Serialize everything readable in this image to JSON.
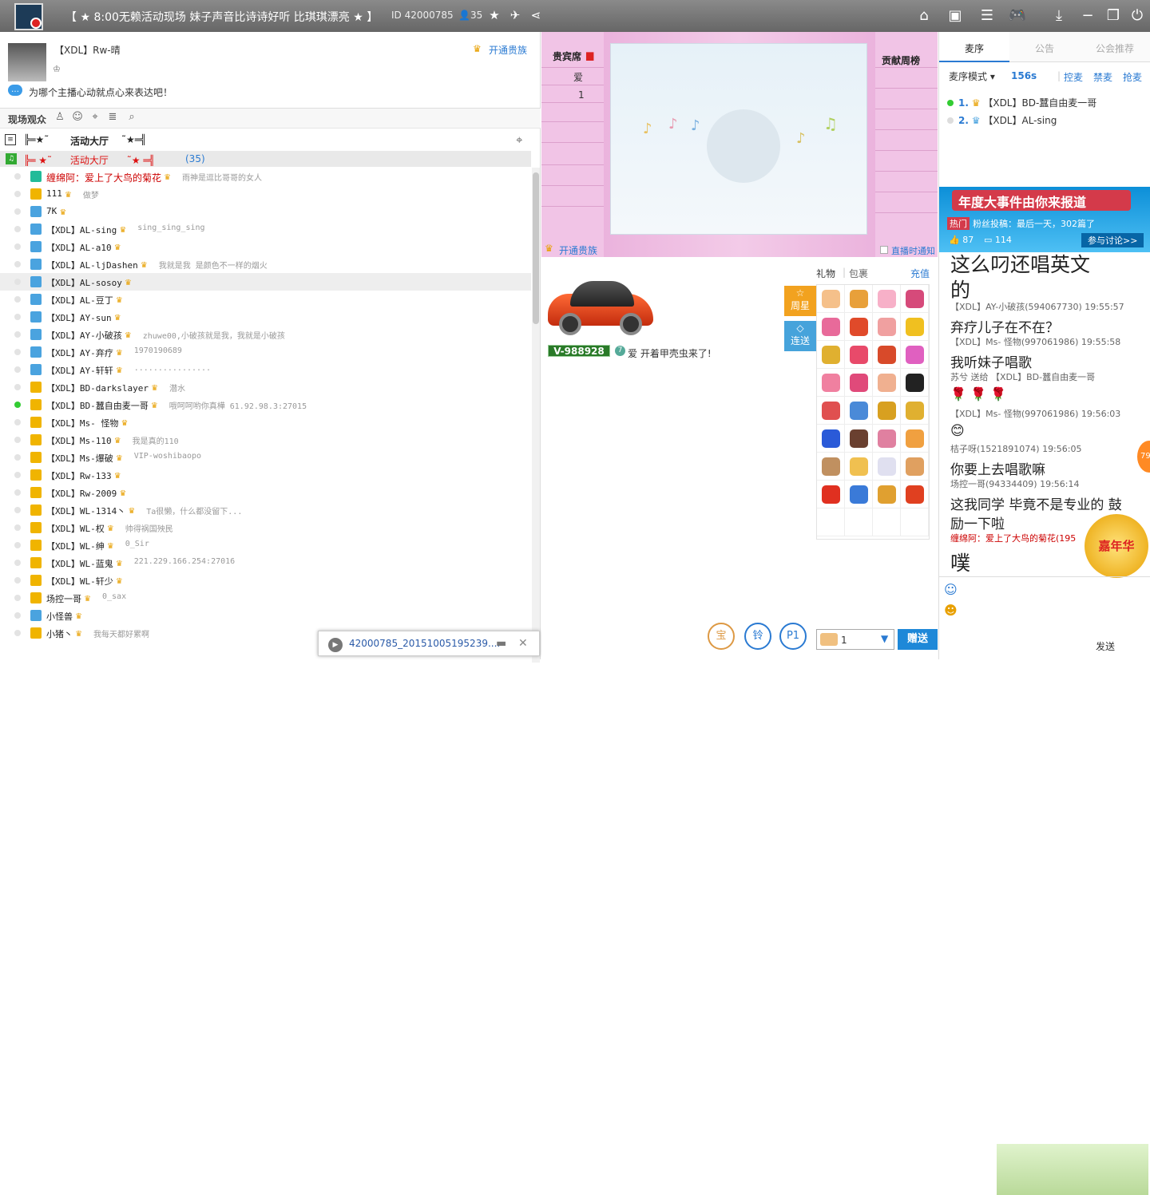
{
  "window": {
    "title": "【 ★ 8:00无赖活动现场 妹子声音比诗诗好听 比琪琪漂亮 ★ 】",
    "room_id": "ID 42000785",
    "online": "35"
  },
  "user": {
    "name": "【XDL】Rw-晴",
    "vip_link": "开通贵族",
    "tip": "为哪个主播心动就点心来表达吧！"
  },
  "audience": {
    "label": "现场观众",
    "icons": [
      "user-icon",
      "face-icon",
      "location-icon",
      "list-icon",
      "search-icon"
    ]
  },
  "channel": {
    "items": [
      "╠═★˜",
      "活动大厅",
      "˜★═╣"
    ],
    "row_text": "╠═ ★˜      活动大厅      ˜★ ═╣",
    "row_count": "(35)"
  },
  "members": [
    {
      "name": "缠绵阿：爱上了大鸟的菊花",
      "sign": "雨神是逗比哥哥的女人",
      "dot": "off",
      "rank": "#2b9",
      "red": true
    },
    {
      "name": "111",
      "sign": "做梦",
      "dot": "off",
      "rank": "#f0b400"
    },
    {
      "name": "7K",
      "sign": "",
      "dot": "off",
      "rank": "#4aa3df"
    },
    {
      "name": "【XDL】AL-sing",
      "sign": "sing_sing_sing",
      "dot": "off",
      "rank": "#4aa3df"
    },
    {
      "name": "【XDL】AL-a10",
      "sign": "",
      "dot": "off",
      "rank": "#4aa3df"
    },
    {
      "name": "【XDL】AL-ljDashen",
      "sign": "我就是我 是颜色不一样的烟火",
      "dot": "off",
      "rank": "#4aa3df"
    },
    {
      "name": "【XDL】AL-sosoy",
      "sign": "",
      "dot": "off",
      "rank": "#4aa3df",
      "hl": true
    },
    {
      "name": "【XDL】AL-豆丁",
      "sign": "",
      "dot": "off",
      "rank": "#4aa3df"
    },
    {
      "name": "【XDL】AY-sun",
      "sign": "",
      "dot": "off",
      "rank": "#4aa3df"
    },
    {
      "name": "【XDL】AY-小破孩",
      "sign": "zhuwe00,小破孩就是我，我就是小破孩",
      "dot": "off",
      "rank": "#4aa3df"
    },
    {
      "name": "【XDL】AY-弃疗",
      "sign": "1970190689",
      "dot": "off",
      "rank": "#4aa3df"
    },
    {
      "name": "【XDL】AY-轩轩",
      "sign": "................",
      "dot": "off",
      "rank": "#4aa3df"
    },
    {
      "name": "【XDL】BD-darkslayer",
      "sign": "潜水",
      "dot": "off",
      "rank": "#f0b400"
    },
    {
      "name": "【XDL】BD-蠶自由麦一哥",
      "sign": "哦呵呵哟你真樺 61.92.98.3:27015",
      "dot": "on",
      "rank": "#f0b400"
    },
    {
      "name": "【XDL】Ms- 怪物",
      "sign": "",
      "dot": "off",
      "rank": "#f0b400"
    },
    {
      "name": "【XDL】Ms-110",
      "sign": "我是真的110",
      "dot": "off",
      "rank": "#f0b400"
    },
    {
      "name": "【XDL】Ms-爆破",
      "sign": "VIP-woshibaopo",
      "dot": "off",
      "rank": "#f0b400"
    },
    {
      "name": "【XDL】Rw-133",
      "sign": "",
      "dot": "off",
      "rank": "#f0b400"
    },
    {
      "name": "【XDL】Rw-2009",
      "sign": "",
      "dot": "off",
      "rank": "#f0b400"
    },
    {
      "name": "【XDL】WL-1314丶",
      "sign": "Ta很懒，什么都没留下...",
      "dot": "off",
      "rank": "#f0b400"
    },
    {
      "name": "【XDL】WL-权",
      "sign": "帅得祸国殃民",
      "dot": "off",
      "rank": "#f0b400"
    },
    {
      "name": "【XDL】WL-绅",
      "sign": "0_Sir",
      "dot": "off",
      "rank": "#f0b400"
    },
    {
      "name": "【XDL】WL-蓝鬼",
      "sign": "221.229.166.254:27016",
      "dot": "off",
      "rank": "#f0b400"
    },
    {
      "name": "【XDL】WL-轩少",
      "sign": "",
      "dot": "off",
      "rank": "#f0b400"
    },
    {
      "name": "场控一哥",
      "sign": "0_sax",
      "dot": "off",
      "rank": "#f0b400"
    },
    {
      "name": "小怪兽",
      "sign": "",
      "dot": "off",
      "rank": "#4aa3df"
    },
    {
      "name": "小猪丶",
      "sign": "我每天都好累啊",
      "dot": "off",
      "rank": "#f0b400"
    }
  ],
  "download": {
    "file": "42000785_20151005195239...."
  },
  "stage": {
    "vip_seat": "贵宾席",
    "seat_ai": "爱",
    "seat_one": "1",
    "contrib": "贡献周榜",
    "vip_link": "开通贵族",
    "notify": "直播时通知"
  },
  "car": {
    "plate": "V-988928",
    "greet": "爱 开着甲壳虫来了!"
  },
  "gifts": {
    "tab_gift": "礼物",
    "tab_bag": "包裹",
    "recharge": "充值",
    "weekly_star": "周星",
    "continuous": "连送",
    "quantity": "1",
    "send": "赠送",
    "colors": [
      "#f5c08a",
      "#e8a03a",
      "#f7b0c8",
      "#d64a7a",
      "#e86a9a",
      "#e04a2a",
      "#f0a0a0",
      "#f0c020",
      "#e0b030",
      "#e84a6a",
      "#d84a2a",
      "#e060c0",
      "#f080a0",
      "#e04a7a",
      "#f0b090",
      "#222222",
      "#e05050",
      "#4a8ad8",
      "#d8a020",
      "#e0b030",
      "#2a5ad8",
      "#6a4030",
      "#e080a0",
      "#f0a040",
      "#c09060",
      "#f0c050",
      "#e0e0f0",
      "#e0a060",
      "#e03020",
      "#3a7ad8",
      "#e0a030",
      "#e04020"
    ]
  },
  "round_buttons": [
    "宝",
    "铃",
    "P1"
  ],
  "right": {
    "tabs": [
      "麦序",
      "公告",
      "公会推荐"
    ],
    "mode_label": "麦序模式",
    "mode_sec": "156s",
    "actions": [
      "控麦",
      "禁麦",
      "抢麦"
    ],
    "mic": [
      {
        "idx": "1.",
        "name": "【XDL】BD-蠶自由麦一哥",
        "on": true
      },
      {
        "idx": "2.",
        "name": "【XDL】AL-sing",
        "on": false
      }
    ]
  },
  "banner": {
    "title": "年度大事件由你来报道",
    "hot": "热门",
    "text": "粉丝投稿：最后一天，302篇了",
    "likes": "87",
    "comments": "114",
    "join": "参与讨论>>"
  },
  "chat": [
    {
      "type": "huge",
      "text": "这么叼还唱英文"
    },
    {
      "type": "huge",
      "text": "的"
    },
    {
      "type": "meta",
      "text": "【XDL】AY-小破孩(594067730) 19:55:57"
    },
    {
      "type": "big",
      "text": "弃疗儿子在不在？"
    },
    {
      "type": "meta",
      "text": "【XDL】Ms- 怪物(997061986) 19:55:58"
    },
    {
      "type": "big",
      "text": "我听妹子唱歌"
    },
    {
      "type": "meta",
      "text": "苏兮 送给 【XDL】BD-蠶自由麦一哥"
    },
    {
      "type": "rose",
      "text": "🌹 🌹 🌹"
    },
    {
      "type": "meta",
      "text": "【XDL】Ms- 怪物(997061986) 19:56:03"
    },
    {
      "type": "big",
      "text": "😊"
    },
    {
      "type": "meta",
      "text": "桔子呀(1521891074) 19:56:05"
    },
    {
      "type": "big",
      "text": "你要上去唱歌嘛"
    },
    {
      "type": "meta",
      "text": "场控一哥(94334409) 19:56:14"
    },
    {
      "type": "big",
      "text": "这我同学 毕竟不是专业的 鼓"
    },
    {
      "type": "big",
      "text": "励一下啦"
    },
    {
      "type": "red",
      "text": "缠绵阿：爱上了大鸟的菊花(195"
    },
    {
      "type": "huge",
      "text": "噗"
    }
  ],
  "chat_bottom": {
    "send": "发送",
    "badge": "嘉年华",
    "ring": "79"
  }
}
